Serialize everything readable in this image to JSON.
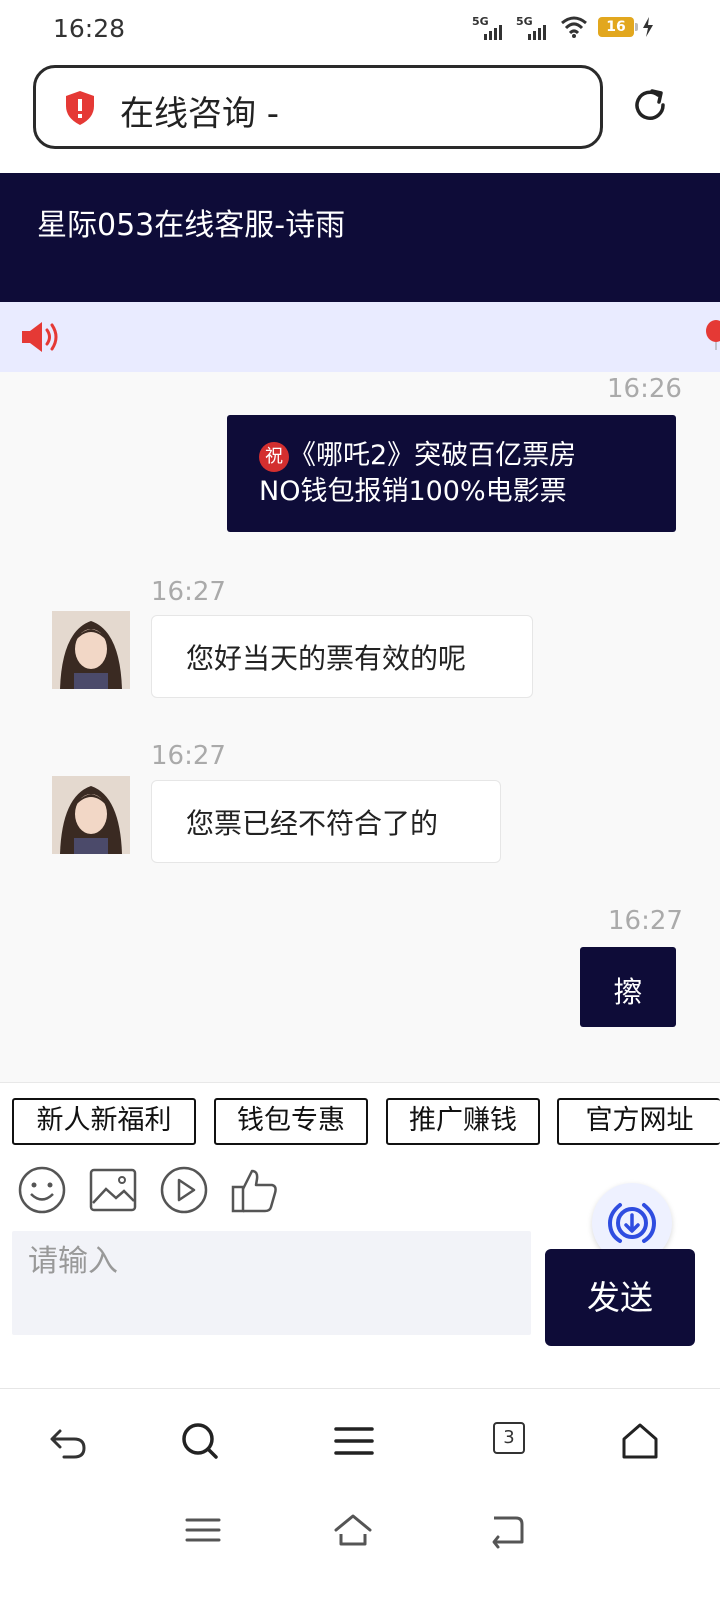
{
  "status_bar": {
    "time": "16:28",
    "signal1": "5G",
    "signal2": "5G",
    "battery": "16"
  },
  "browser": {
    "url_text": "在线咨询 -"
  },
  "chat": {
    "title": "星际053在线客服-诗雨",
    "messages": [
      {
        "time": "16:26",
        "badge": "祝",
        "line1": "《哪吒2》突破百亿票房",
        "line2": "NO钱包报销100%电影票"
      },
      {
        "time": "16:27",
        "text": "您好当天的票有效的呢"
      },
      {
        "time": "16:27",
        "text": "您票已经不符合了的"
      },
      {
        "time": "16:27",
        "text": "擦"
      }
    ]
  },
  "quick_tags": [
    "新人新福利",
    "钱包专惠",
    "推广赚钱",
    "官方网址"
  ],
  "composer": {
    "placeholder": "请输入",
    "send_label": "发送"
  },
  "browser_nav": {
    "tabs_count": "3"
  },
  "colors": {
    "accent": "#0e0c38",
    "notice_bg": "#e9ebff",
    "alert_red": "#e53935"
  }
}
